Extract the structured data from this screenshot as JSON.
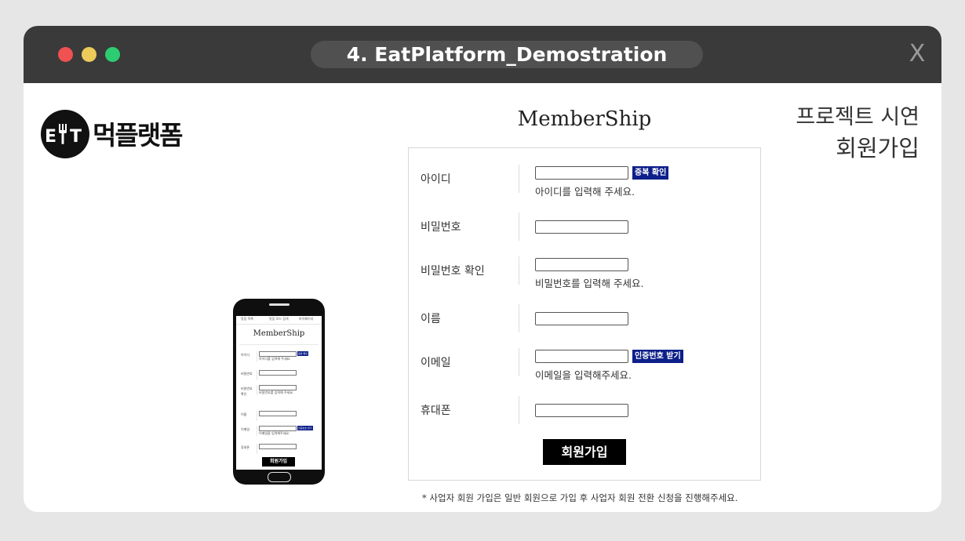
{
  "window": {
    "title": "4. EatPlatform_Demostration",
    "close_label": "X"
  },
  "logo": {
    "mark_text": "EAT",
    "name": "먹플랫폼"
  },
  "project": {
    "line1": "프로젝트 시연",
    "line2": "회원가입"
  },
  "form": {
    "title": "MemberShip",
    "fields": [
      {
        "label": "아이디",
        "button": "중복 확인",
        "hint": "아이디를 입력해 주세요."
      },
      {
        "label": "비밀번호"
      },
      {
        "label": "비밀번호 확인",
        "hint": "비밀번호를 입력해 주세요."
      },
      {
        "label": "이름"
      },
      {
        "label": "이메일",
        "button": "인증번호 받기",
        "hint": "이메일을 입력해주세요."
      },
      {
        "label": "휴대폰"
      }
    ],
    "submit_label": "회원가입",
    "footnote": "* 사업자 회원 가입은 일반 회원으로 가입 후 사업자 회원 전환 신청을 진행해주세요."
  },
  "phone": {
    "nav": [
      "맛집 목록",
      "맛집 모드 검색",
      "마이페이지"
    ],
    "title": "MemberShip",
    "fields": [
      {
        "label": "아이디",
        "button": "중복 확인",
        "hint": "아이디를 입력해 주세요."
      },
      {
        "label": "비밀번호"
      },
      {
        "label": "비밀번호",
        "label2": "확인",
        "hint": "비밀번호를 입력해 주세요."
      },
      {
        "label": "이름"
      },
      {
        "label": "이메일",
        "button": "인증번호 받기",
        "hint": "이메일을 입력해주세요."
      },
      {
        "label": "휴대폰"
      }
    ],
    "submit_label": "회원가입"
  },
  "colors": {
    "background": "#e6e6e6",
    "titlebar": "#3a3a3a",
    "accent_button": "#0d1f8a",
    "traffic_red": "#f05151",
    "traffic_yellow": "#eccb5a",
    "traffic_green": "#2ecc71"
  }
}
